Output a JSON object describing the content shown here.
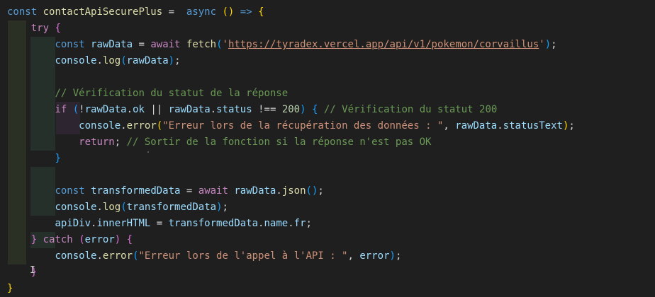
{
  "editor": {
    "lines": [
      {
        "segs": [
          [
            "kw",
            "const"
          ],
          [
            "punc",
            " "
          ],
          [
            "fn",
            "contactApiSecurePlus"
          ],
          [
            "punc",
            " = "
          ],
          [
            "kw",
            " async"
          ],
          [
            "punc",
            " "
          ],
          [
            "br1",
            "()"
          ],
          [
            "punc",
            " "
          ],
          [
            "kw",
            "=>"
          ],
          [
            "punc",
            " "
          ],
          [
            "br1",
            "{"
          ]
        ]
      },
      {
        "segs": [
          [
            "punc",
            "    "
          ],
          [
            "ctrl",
            "try"
          ],
          [
            "punc",
            " "
          ],
          [
            "br2",
            "{"
          ]
        ]
      },
      {
        "segs": [
          [
            "punc",
            "        "
          ],
          [
            "kw",
            "const"
          ],
          [
            "punc",
            " "
          ],
          [
            "var",
            "rawData"
          ],
          [
            "punc",
            " = "
          ],
          [
            "ctrl",
            "await"
          ],
          [
            "punc",
            " "
          ],
          [
            "fn",
            "fetch"
          ],
          [
            "br3",
            "("
          ],
          [
            "str",
            "'"
          ],
          [
            "str url",
            "https://tyradex.vercel.app/api/v1/pokemon/corvaillus"
          ],
          [
            "str",
            "'"
          ],
          [
            "br3",
            ")"
          ],
          [
            "punc",
            ";"
          ]
        ]
      },
      {
        "segs": [
          [
            "punc",
            "        "
          ],
          [
            "var",
            "console"
          ],
          [
            "punc",
            "."
          ],
          [
            "fn",
            "log"
          ],
          [
            "br3",
            "("
          ],
          [
            "var",
            "rawData"
          ],
          [
            "br3",
            ")"
          ],
          [
            "punc",
            ";"
          ]
        ]
      },
      {
        "segs": [
          [
            "punc",
            ""
          ]
        ]
      },
      {
        "segs": [
          [
            "punc",
            "        "
          ],
          [
            "cmt",
            "// Vérification du statut de la réponse"
          ]
        ]
      },
      {
        "segs": [
          [
            "punc",
            "        "
          ],
          [
            "ctrl",
            "if"
          ],
          [
            "punc",
            " "
          ],
          [
            "br3",
            "("
          ],
          [
            "op",
            "!"
          ],
          [
            "var",
            "rawData"
          ],
          [
            "punc",
            "."
          ],
          [
            "prop",
            "ok"
          ],
          [
            "punc",
            " || "
          ],
          [
            "var",
            "rawData"
          ],
          [
            "punc",
            "."
          ],
          [
            "prop",
            "status"
          ],
          [
            "punc",
            " !== "
          ],
          [
            "num",
            "200"
          ],
          [
            "br3",
            ")"
          ],
          [
            "punc",
            " "
          ],
          [
            "br3",
            "{"
          ],
          [
            "punc",
            " "
          ],
          [
            "cmt",
            "// Vérification du statut 200"
          ]
        ]
      },
      {
        "segs": [
          [
            "punc",
            "            "
          ],
          [
            "var",
            "console"
          ],
          [
            "punc",
            "."
          ],
          [
            "fn",
            "error"
          ],
          [
            "br1",
            "("
          ],
          [
            "str",
            "\"Erreur lors de la récupération des données : \""
          ],
          [
            "punc",
            ", "
          ],
          [
            "var",
            "rawData"
          ],
          [
            "punc",
            "."
          ],
          [
            "prop",
            "statusText"
          ],
          [
            "br1",
            ")"
          ],
          [
            "punc",
            ";"
          ]
        ]
      },
      {
        "segs": [
          [
            "punc",
            "            "
          ],
          [
            "ctrl",
            "return"
          ],
          [
            "punc",
            "; "
          ],
          [
            "cmt",
            "// Sortir de la fonction si la réponse n'est pas OK"
          ]
        ]
      },
      {
        "segs": [
          [
            "punc",
            "        "
          ],
          [
            "br3",
            "}"
          ]
        ]
      },
      {
        "segs": [
          [
            "punc",
            ""
          ]
        ]
      },
      {
        "segs": [
          [
            "punc",
            "        "
          ],
          [
            "kw",
            "const"
          ],
          [
            "punc",
            " "
          ],
          [
            "var",
            "transformedData"
          ],
          [
            "punc",
            " = "
          ],
          [
            "ctrl",
            "await"
          ],
          [
            "punc",
            " "
          ],
          [
            "var",
            "rawData"
          ],
          [
            "punc",
            "."
          ],
          [
            "fn",
            "json"
          ],
          [
            "br3",
            "()"
          ],
          [
            "punc",
            ";"
          ]
        ]
      },
      {
        "segs": [
          [
            "punc",
            "        "
          ],
          [
            "var",
            "console"
          ],
          [
            "punc",
            "."
          ],
          [
            "fn",
            "log"
          ],
          [
            "br3",
            "("
          ],
          [
            "var",
            "transformedData"
          ],
          [
            "br3",
            ")"
          ],
          [
            "punc",
            ";"
          ]
        ]
      },
      {
        "segs": [
          [
            "punc",
            "        "
          ],
          [
            "var",
            "apiDiv"
          ],
          [
            "punc",
            "."
          ],
          [
            "prop",
            "innerHTML"
          ],
          [
            "punc",
            " = "
          ],
          [
            "var",
            "transformedData"
          ],
          [
            "punc",
            "."
          ],
          [
            "prop",
            "name"
          ],
          [
            "punc",
            "."
          ],
          [
            "prop",
            "fr"
          ],
          [
            "punc",
            ";"
          ]
        ]
      },
      {
        "segs": [
          [
            "punc",
            "    "
          ],
          [
            "br2",
            "}"
          ],
          [
            "punc",
            " "
          ],
          [
            "ctrl",
            "catch"
          ],
          [
            "punc",
            " "
          ],
          [
            "br2",
            "("
          ],
          [
            "var",
            "error"
          ],
          [
            "br2",
            ")"
          ],
          [
            "punc",
            " "
          ],
          [
            "br2",
            "{"
          ]
        ]
      },
      {
        "segs": [
          [
            "punc",
            "        "
          ],
          [
            "var",
            "console"
          ],
          [
            "punc",
            "."
          ],
          [
            "fn",
            "error"
          ],
          [
            "br3",
            "("
          ],
          [
            "str",
            "\"Erreur lors de l'appel à l'API : \""
          ],
          [
            "punc",
            ", "
          ],
          [
            "var",
            "error"
          ],
          [
            "br3",
            ")"
          ],
          [
            "punc",
            ";"
          ]
        ]
      },
      {
        "segs": [
          [
            "punc",
            "    "
          ],
          [
            "br2",
            "}"
          ]
        ]
      },
      {
        "segs": [
          [
            "br1",
            "}"
          ]
        ]
      }
    ]
  }
}
